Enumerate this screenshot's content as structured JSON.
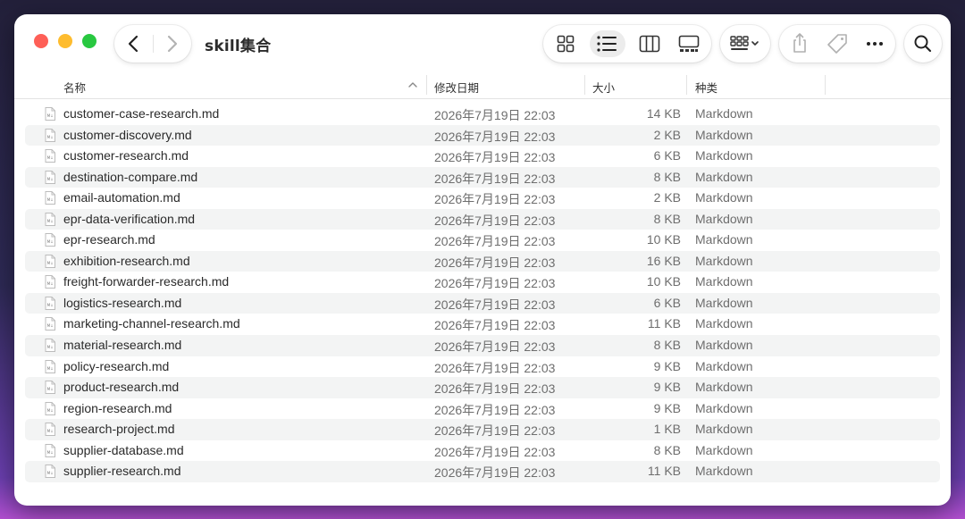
{
  "window": {
    "title": "skill集合"
  },
  "columns": {
    "name": "名称",
    "modified": "修改日期",
    "size": "大小",
    "kind": "种类"
  },
  "files": [
    {
      "name": "customer-case-research.md",
      "modified": "2026年7月19日 22:03",
      "size": "14 KB",
      "kind": "Markdown"
    },
    {
      "name": "customer-discovery.md",
      "modified": "2026年7月19日 22:03",
      "size": "2 KB",
      "kind": "Markdown"
    },
    {
      "name": "customer-research.md",
      "modified": "2026年7月19日 22:03",
      "size": "6 KB",
      "kind": "Markdown"
    },
    {
      "name": "destination-compare.md",
      "modified": "2026年7月19日 22:03",
      "size": "8 KB",
      "kind": "Markdown"
    },
    {
      "name": "email-automation.md",
      "modified": "2026年7月19日 22:03",
      "size": "2 KB",
      "kind": "Markdown"
    },
    {
      "name": "epr-data-verification.md",
      "modified": "2026年7月19日 22:03",
      "size": "8 KB",
      "kind": "Markdown"
    },
    {
      "name": "epr-research.md",
      "modified": "2026年7月19日 22:03",
      "size": "10 KB",
      "kind": "Markdown"
    },
    {
      "name": "exhibition-research.md",
      "modified": "2026年7月19日 22:03",
      "size": "16 KB",
      "kind": "Markdown"
    },
    {
      "name": "freight-forwarder-research.md",
      "modified": "2026年7月19日 22:03",
      "size": "10 KB",
      "kind": "Markdown"
    },
    {
      "name": "logistics-research.md",
      "modified": "2026年7月19日 22:03",
      "size": "6 KB",
      "kind": "Markdown"
    },
    {
      "name": "marketing-channel-research.md",
      "modified": "2026年7月19日 22:03",
      "size": "11 KB",
      "kind": "Markdown"
    },
    {
      "name": "material-research.md",
      "modified": "2026年7月19日 22:03",
      "size": "8 KB",
      "kind": "Markdown"
    },
    {
      "name": "policy-research.md",
      "modified": "2026年7月19日 22:03",
      "size": "9 KB",
      "kind": "Markdown"
    },
    {
      "name": "product-research.md",
      "modified": "2026年7月19日 22:03",
      "size": "9 KB",
      "kind": "Markdown"
    },
    {
      "name": "region-research.md",
      "modified": "2026年7月19日 22:03",
      "size": "9 KB",
      "kind": "Markdown"
    },
    {
      "name": "research-project.md",
      "modified": "2026年7月19日 22:03",
      "size": "1 KB",
      "kind": "Markdown"
    },
    {
      "name": "supplier-database.md",
      "modified": "2026年7月19日 22:03",
      "size": "8 KB",
      "kind": "Markdown"
    },
    {
      "name": "supplier-research.md",
      "modified": "2026年7月19日 22:03",
      "size": "11 KB",
      "kind": "Markdown"
    }
  ],
  "file_icon_label": "M↓",
  "icons": {
    "back": "chevron-left-icon",
    "forward": "chevron-right-icon",
    "icon_view": "grid-icon",
    "list_view": "list-icon",
    "column_view": "columns-icon",
    "gallery_view": "gallery-icon",
    "group": "group-icon",
    "share": "share-icon",
    "tags": "tag-icon",
    "more": "ellipsis-icon",
    "search": "search-icon"
  },
  "active_view": "list",
  "colors": {
    "close": "#fe5f57",
    "minimize": "#febc2e",
    "maximize": "#28c840"
  }
}
